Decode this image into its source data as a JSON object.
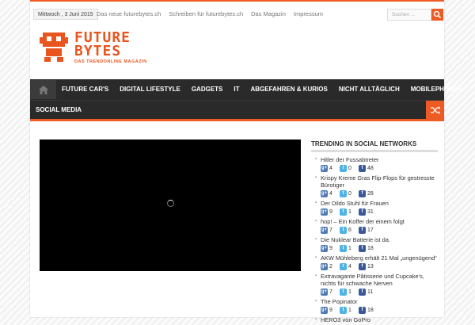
{
  "topbar": {
    "date": "Mittwoch , 3 Juni 2015",
    "links": [
      "Das neue futurebytes.ch",
      "Schreiben für futurebytes.ch",
      "Das Magazin",
      "Impressum"
    ],
    "search_placeholder": "Suchen ..."
  },
  "logo": {
    "line1": "FUTURE",
    "line2": "BYTES",
    "tagline": "DAS TRENDONLINE MAGAZIN"
  },
  "nav": {
    "items": [
      "FUTURE CAR'S",
      "DIGITAL LIFESTYLE",
      "GADGETS",
      "IT",
      "ABGEFAHREN & KURIOS",
      "NICHT ALLTÄGLICH",
      "MOBILEPHONES"
    ],
    "row2": [
      "SOCIAL MEDIA"
    ]
  },
  "trending": {
    "title": "TRENDING IN SOCIAL NETWORKS",
    "items": [
      {
        "title": "Hitler der Fussabtreter",
        "gplus": "4",
        "twitter": "0",
        "facebook": "48"
      },
      {
        "title": "Krispy Kreme Gras Flip-Flops für gestresste Bürotiger",
        "gplus": "4",
        "twitter": "0",
        "facebook": "28"
      },
      {
        "title": "Der Dildo Stuhl für Frauen",
        "gplus": "9",
        "twitter": "1",
        "facebook": "31"
      },
      {
        "title": "hop! – Ein Koffer der einem folgt",
        "gplus": "7",
        "twitter": "6",
        "facebook": "17"
      },
      {
        "title": "Die Nuklear Batterie ist da.",
        "gplus": "9",
        "twitter": "1",
        "facebook": "18"
      },
      {
        "title": "AKW Mühleberg erhält 21 Mal „ungenügend“",
        "gplus": "2",
        "twitter": "4",
        "facebook": "13"
      },
      {
        "title": "Extravagante Pâtisserie und Cupcake's, nichts für schwache Nerven",
        "gplus": "7",
        "twitter": "1",
        "facebook": "11"
      },
      {
        "title": "The Popinator",
        "gplus": "9",
        "twitter": "1",
        "facebook": "18"
      },
      {
        "title": "HERO3 von GoPro",
        "gplus": "",
        "twitter": "",
        "facebook": ""
      }
    ]
  },
  "colors": {
    "accent": "#ee5a24",
    "nav_bg": "#2a2a2a"
  }
}
